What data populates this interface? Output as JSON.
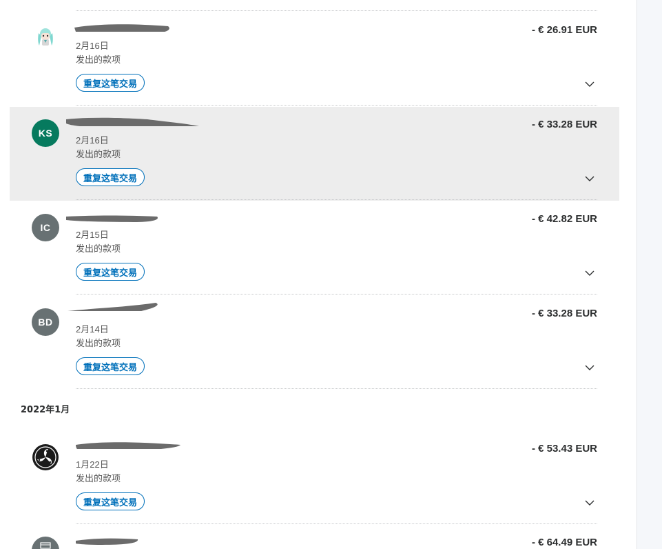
{
  "transactions": [
    {
      "avatar_type": "image",
      "avatar_icon": "anime-character-avatar-icon",
      "name": "",
      "date": "2月16日",
      "type": "发出的款项",
      "amount": "- € 26.91 EUR",
      "repeat_label": "重复这笔交易",
      "highlighted": false
    },
    {
      "avatar_type": "initials",
      "initials": "KS",
      "avatar_color": "#067a5e",
      "name": "",
      "date": "2月16日",
      "type": "发出的款项",
      "amount": "- € 33.28 EUR",
      "repeat_label": "重复这笔交易",
      "highlighted": true
    },
    {
      "avatar_type": "initials",
      "initials": "IC",
      "avatar_color": "#687173",
      "name": "",
      "date": "2月15日",
      "type": "发出的款项",
      "amount": "- € 42.82 EUR",
      "repeat_label": "重复这笔交易",
      "highlighted": false
    },
    {
      "avatar_type": "initials",
      "initials": "BD",
      "avatar_color": "#687173",
      "name": "",
      "date": "2月14日",
      "type": "发出的款项",
      "amount": "- € 33.28 EUR",
      "repeat_label": "重复这笔交易",
      "highlighted": false
    }
  ],
  "month_header": "2022年1月",
  "january_transactions": [
    {
      "avatar_type": "image",
      "avatar_icon": "triskele-logo-avatar-icon",
      "name": "",
      "date": "1月22日",
      "type": "发出的款项",
      "amount": "- € 53.43 EUR",
      "repeat_label": "重复这笔交易"
    },
    {
      "avatar_type": "icon",
      "avatar_icon": "store-icon",
      "name": "",
      "amount": "- € 64.49 EUR"
    }
  ],
  "colors": {
    "accent": "#0070ba",
    "hover_background": "#ededed",
    "text": "#2c2e2f"
  }
}
